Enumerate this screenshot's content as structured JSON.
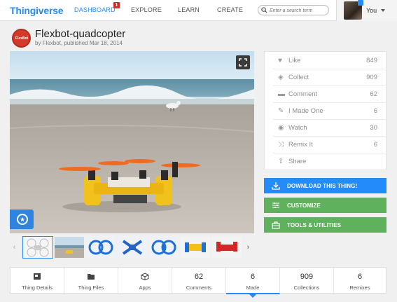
{
  "header": {
    "logo": "Thingiverse",
    "nav": [
      "DASHBOARD",
      "EXPLORE",
      "LEARN",
      "CREATE"
    ],
    "dashboard_badge": "1",
    "search_placeholder": "Enter a search term",
    "user_label": "You"
  },
  "thing": {
    "logo_text": "FlexBot",
    "title": "Flexbot-quadcopter",
    "byline": "by Flexbot, published Mar 18, 2014"
  },
  "stats": [
    {
      "icon": "heart-icon",
      "label": "Like",
      "count": "849"
    },
    {
      "icon": "collect-icon",
      "label": "Collect",
      "count": "909"
    },
    {
      "icon": "comment-icon",
      "label": "Comment",
      "count": "62"
    },
    {
      "icon": "made-icon",
      "label": "I Made One",
      "count": "6"
    },
    {
      "icon": "eye-icon",
      "label": "Watch",
      "count": "30"
    },
    {
      "icon": "remix-icon",
      "label": "Remix It",
      "count": "6"
    },
    {
      "icon": "share-icon",
      "label": "Share",
      "count": ""
    }
  ],
  "actions": {
    "download": "DOWNLOAD THIS THING!",
    "customize": "CUSTOMIZE",
    "tools": "TOOLS & UTILITIES"
  },
  "tabs": [
    {
      "value": "",
      "label": "Thing Details"
    },
    {
      "value": "",
      "label": "Thing Files"
    },
    {
      "value": "",
      "label": "Apps"
    },
    {
      "value": "62",
      "label": "Comments"
    },
    {
      "value": "6",
      "label": "Made"
    },
    {
      "value": "909",
      "label": "Collections"
    },
    {
      "value": "6",
      "label": "Remixes"
    }
  ],
  "colors": {
    "brand_blue": "#248bfb",
    "green": "#5fb15d",
    "badge_red": "#d62a2a"
  }
}
